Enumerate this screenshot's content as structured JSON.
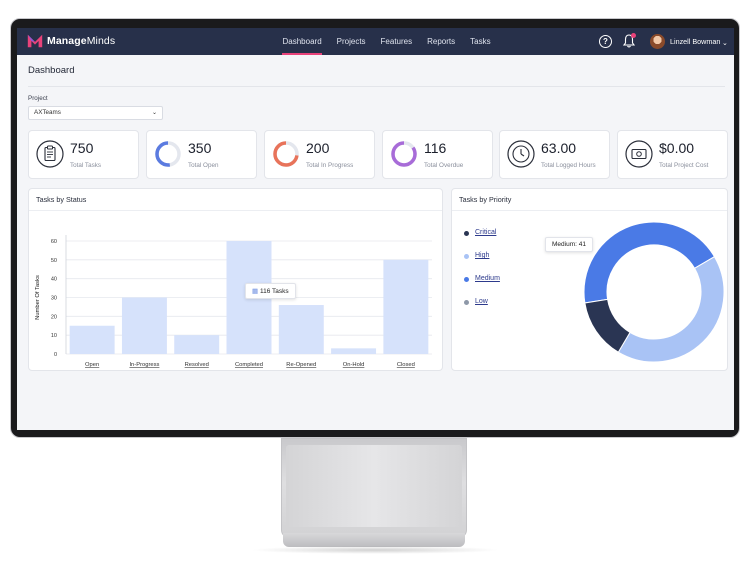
{
  "app": {
    "brand_bold": "Manage",
    "brand_rest": "Minds"
  },
  "nav": {
    "items": [
      {
        "label": "Dashboard",
        "active": true
      },
      {
        "label": "Projects",
        "active": false
      },
      {
        "label": "Features",
        "active": false
      },
      {
        "label": "Reports",
        "active": false
      },
      {
        "label": "Tasks",
        "active": false
      }
    ],
    "help_label": "?",
    "user_name": "Linzell Bowman",
    "user_chevron": "⌄"
  },
  "page": {
    "title": "Dashboard"
  },
  "project": {
    "label": "Project",
    "selected": "AXTeams"
  },
  "stats": [
    {
      "value": "750",
      "label": "Total Tasks",
      "icon": "clipboard-icon"
    },
    {
      "value": "350",
      "label": "Total Open",
      "icon": "ring-progress-icon",
      "progress": 0.47,
      "color": "#5b7be0"
    },
    {
      "value": "200",
      "label": "Total In Progress",
      "icon": "ring-progress-icon",
      "progress": 0.27,
      "color": "#e8735a"
    },
    {
      "value": "116",
      "label": "Total Overdue",
      "icon": "ring-progress-icon",
      "progress": 0.15,
      "color": "#a86cd8"
    },
    {
      "value": "63.00",
      "label": "Total Logged Hours",
      "icon": "clock-icon"
    },
    {
      "value": "$0.00",
      "label": "Total Project Cost",
      "icon": "cash-icon"
    }
  ],
  "status_chart": {
    "title": "Tasks by Status",
    "tooltip": "116 Tasks",
    "chart_data": {
      "type": "bar",
      "categories": [
        "Open",
        "In-Progress",
        "Resolved",
        "Completed",
        "Re-Opened",
        "On-Hold",
        "Closed"
      ],
      "values": [
        15,
        30,
        10,
        60,
        26,
        3,
        50
      ],
      "ylabel": "Number Of Tasks",
      "yticks": [
        0,
        10,
        20,
        30,
        40,
        50,
        60
      ],
      "ylim": [
        0,
        60
      ],
      "grid": true,
      "color": "#d6e2fb"
    }
  },
  "priority_chart": {
    "title": "Tasks by Priority",
    "tooltip": "Medium: 41",
    "chart_data": {
      "type": "pie",
      "donut": true,
      "categories": [
        "Critical",
        "High",
        "Medium",
        "Low"
      ],
      "values": [
        13,
        39,
        41,
        0
      ],
      "colors": [
        "#2a3553",
        "#a9c3f5",
        "#4a7ae6",
        "#8e98a8"
      ]
    }
  }
}
